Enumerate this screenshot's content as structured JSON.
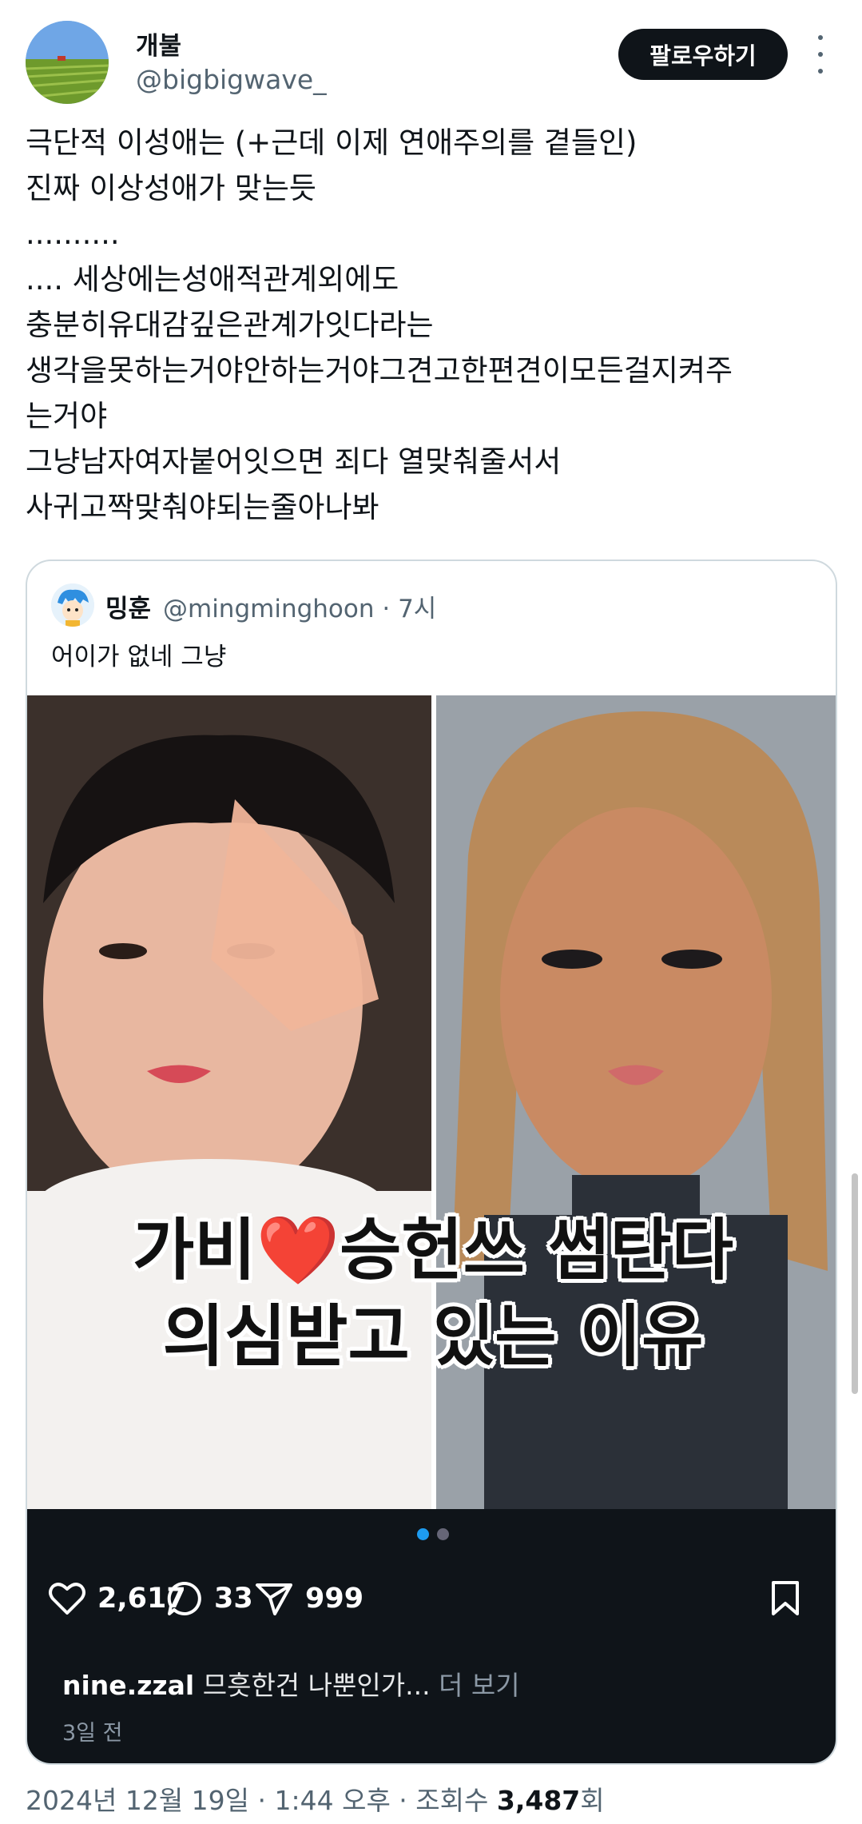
{
  "author": {
    "display_name": "개불",
    "handle": "@bigbigwave_",
    "follow_label": "팔로우하기"
  },
  "tweet_lines": [
    "극단적 이성애는 (+근데 이제 연애주의를 곁들인)",
    "진짜 이상성애가 맞는듯",
    "..........",
    ".... 세상에는성애적관계외에도",
    "충분히유대감깊은관계가잇다라는",
    "생각을못하는거야안하는거야그견고한편견이모든걸지켜주",
    "는거야",
    "그냥남자여자붙어잇으면 죄다 열맞춰줄서서",
    "사귀고짝맞춰야되는줄아나봐"
  ],
  "quote": {
    "name": "밍훈",
    "handle": "@mingminghoon",
    "time": "· 7시",
    "text": "어이가 없네 그냥",
    "media": {
      "caption_line1a": "가비",
      "caption_heart": "❤️",
      "caption_line1b": "승헌쓰 썸탄다",
      "caption_line2": "의심받고 있는 이유",
      "likes": "2,617",
      "comments": "33",
      "shares": "999",
      "post_user": "nine.zzal",
      "post_text": "므흣한건 나뿐인가...",
      "more_label": "더 보기",
      "posted_ago": "3일 전"
    }
  },
  "meta": {
    "date_time": "2024년 12월 19일 · 1:44 오후 · 조회수 ",
    "views": "3,487",
    "views_suffix": "회"
  },
  "colors": {
    "text": "#0f1419",
    "secondary": "#536471",
    "accent": "#1d9bf0",
    "heart": "#e0141c"
  }
}
